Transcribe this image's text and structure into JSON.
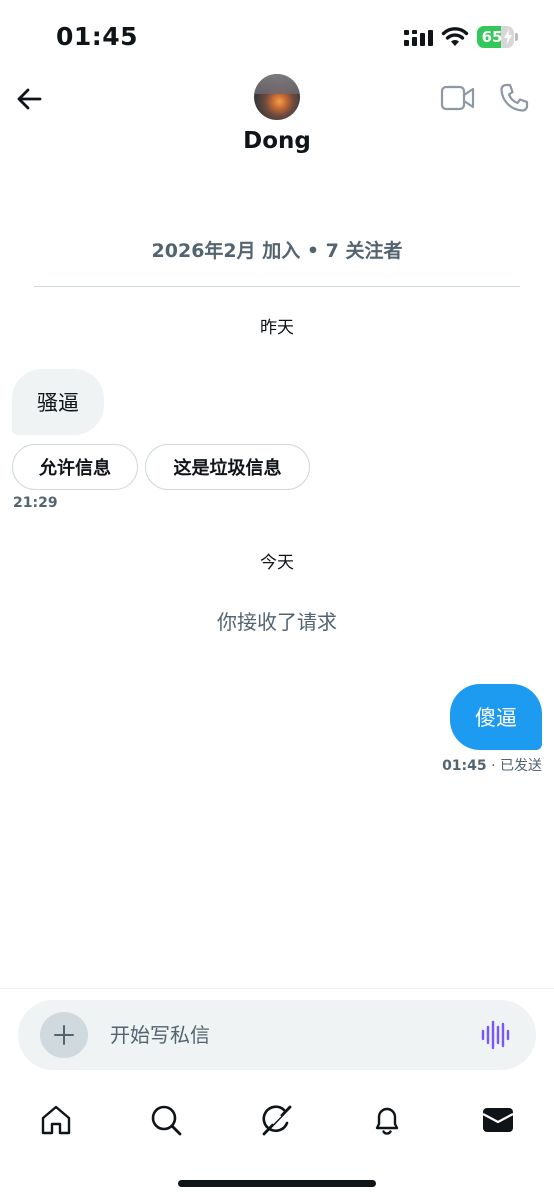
{
  "status_bar": {
    "time": "01:45",
    "battery_level": "65",
    "battery_fraction": 0.65,
    "icons": [
      "signal-icon",
      "wifi-icon",
      "battery-icon",
      "charging-bolt-icon"
    ]
  },
  "header": {
    "contact_name": "Dong",
    "icons": [
      "back-arrow-icon",
      "video-call-icon",
      "phone-icon"
    ]
  },
  "profile": {
    "meta": "2026年2月 加入 • 7 关注者"
  },
  "conversation": {
    "yesterday_label": "昨天",
    "incoming_message": "骚逼",
    "request_actions": {
      "accept": "允许信息",
      "spam": "这是垃圾信息"
    },
    "incoming_time": "21:29",
    "today_label": "今天",
    "system_note": "你接收了请求",
    "outgoing_message": "傻逼",
    "outgoing_time": "01:45",
    "outgoing_status": "· 已发送"
  },
  "composer": {
    "placeholder": "开始写私信",
    "icons": [
      "plus-icon",
      "voice-waveform-icon"
    ]
  },
  "bottom_nav": {
    "items": [
      "home-icon",
      "search-icon",
      "grok-icon",
      "notifications-icon",
      "messages-icon"
    ],
    "active": "messages-icon"
  },
  "colors": {
    "accent": "#1d9bf0",
    "secondary_text": "#536471",
    "bubble_incoming": "#eff3f4",
    "voice_icon": "#7856ff",
    "battery_green": "#34c759"
  }
}
